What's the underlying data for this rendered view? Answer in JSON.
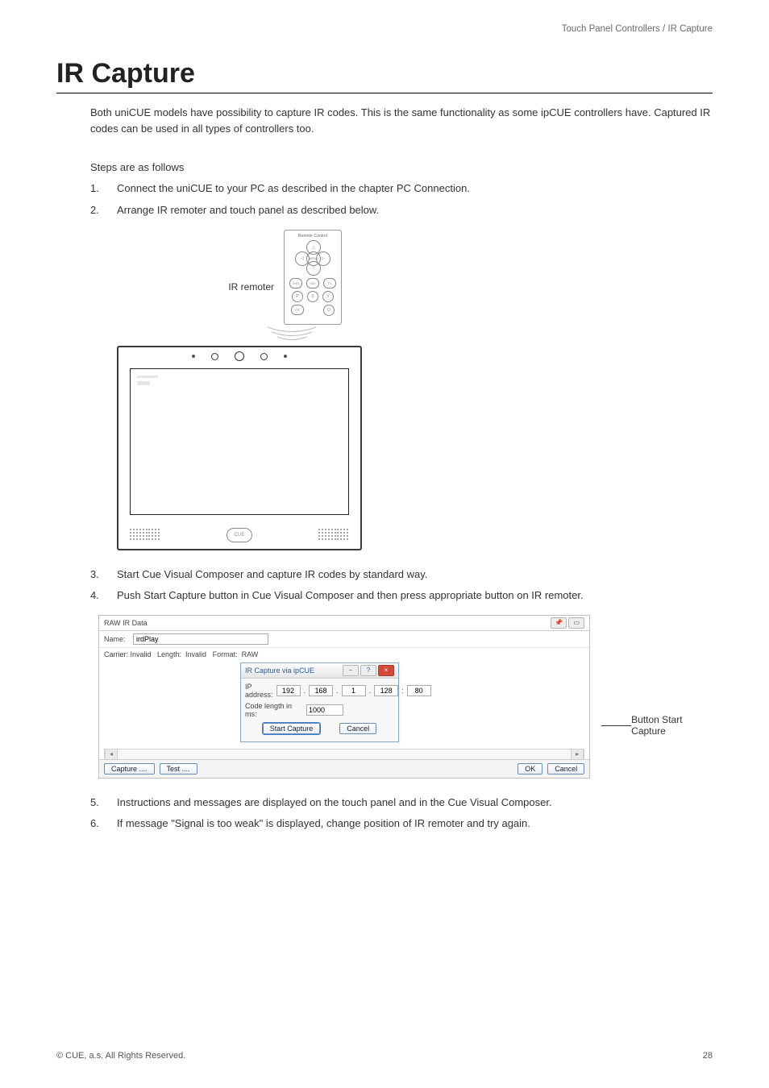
{
  "header": {
    "breadcrumb": "Touch Panel Controllers / IR Capture"
  },
  "page_title": "IR Capture",
  "intro": "Both uniCUE models have possibility to capture IR codes. This is the same functionality as some ipCUE controllers have. Captured IR codes can be used in all types of controllers too.",
  "steps_intro": "Steps are as follows",
  "steps": [
    {
      "n": "1.",
      "t": "Connect the uniCUE to your PC as described in the chapter PC Connection."
    },
    {
      "n": "2.",
      "t": "Arrange IR remoter and touch panel as described below."
    }
  ],
  "figure1": {
    "ir_remoter_label": "IR remoter",
    "remote_title": "Remote Control",
    "btn_menu": "MENU",
    "btn_dvd": "DVD",
    "btn_sat": "SAT",
    "btn_tv": "TV",
    "btn_p": "P",
    "btn_s": "S",
    "btn_v": "V",
    "btn_fr": "FR",
    "btn_pw": "⏻",
    "panel_logo": "CUE"
  },
  "steps_after": [
    {
      "n": "3.",
      "t": "Start Cue Visual Composer and capture IR codes by standard way."
    },
    {
      "n": "4.",
      "t": "Push Start Capture button in Cue Visual Composer and then press appropriate button on IR remoter."
    }
  ],
  "figure2": {
    "outer_title": "RAW IR Data",
    "pin_icon": "📌",
    "restore_icon": "▭",
    "name_label": "Name:",
    "name_value": "irdPlay",
    "status": "Carrier: Invalid   Length:  Invalid   Format:  RAW",
    "inner_title": "IR Capture via ipCUE",
    "help_icon": "?",
    "close_icon": "×",
    "min_icon": "−",
    "row_ip_label": "IP address:",
    "ip1": "192",
    "ip2": "168",
    "ip3": "1",
    "ip4": "128",
    "port": "80",
    "row_len_label": "Code length in ms:",
    "len_value": "1000",
    "btn_start_capture": "Start Capture",
    "btn_cancel_inner": "Cancel",
    "scroll_left": "◂",
    "scroll_right": "▸",
    "btn_capture": "Capture ....",
    "btn_test": "Test ....",
    "btn_ok": "OK",
    "btn_cancel": "Cancel"
  },
  "callout": "Button Start Capture",
  "steps_last": [
    {
      "n": "5.",
      "t": "Instructions and messages are displayed on the touch panel and in the Cue Visual Composer."
    },
    {
      "n": "6.",
      "t": "If message \"Signal is too weak\" is displayed, change position of IR remoter and try again."
    }
  ],
  "footer": {
    "left": "© CUE, a.s. All Rights Reserved.",
    "right": "28"
  }
}
